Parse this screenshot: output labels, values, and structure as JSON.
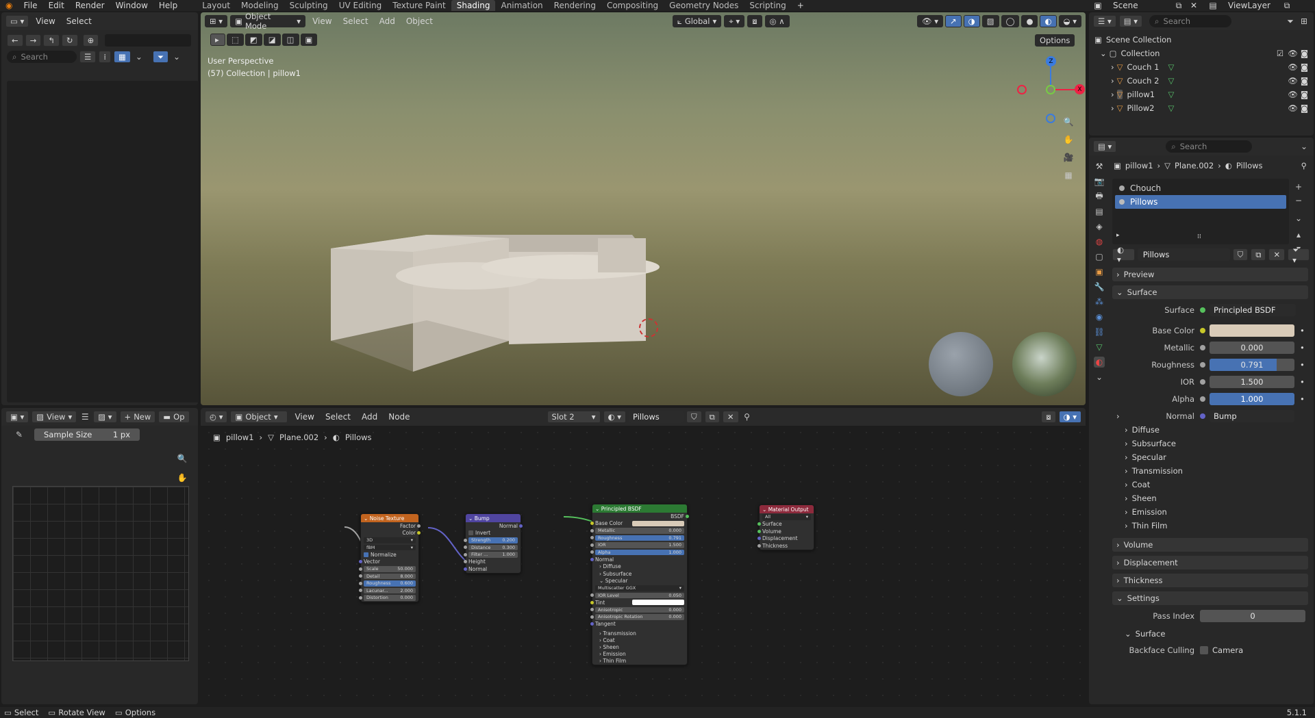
{
  "topbar": {
    "menus": [
      "File",
      "Edit",
      "Render",
      "Window",
      "Help"
    ],
    "workspaces": [
      "Layout",
      "Modeling",
      "Sculpting",
      "UV Editing",
      "Texture Paint",
      "Shading",
      "Animation",
      "Rendering",
      "Compositing",
      "Geometry Nodes",
      "Scripting"
    ],
    "active_workspace": "Shading",
    "scene": "Scene",
    "view_layer": "ViewLayer"
  },
  "filebrowser": {
    "menus": [
      "View",
      "Select"
    ],
    "search_placeholder": "Search"
  },
  "viewport": {
    "mode": "Object Mode",
    "menus": [
      "View",
      "Select",
      "Add",
      "Object"
    ],
    "orientation": "Global",
    "options": "Options",
    "overlay_line1": "User Perspective",
    "overlay_line2": "(57) Collection | pillow1",
    "gizmo": {
      "z": "Z",
      "x": "X"
    }
  },
  "image_editor": {
    "view": "View",
    "new": "New",
    "open": "Op",
    "sample_label": "Sample Size",
    "sample_value": "1 px"
  },
  "node_editor": {
    "type": "Object",
    "menus": [
      "View",
      "Select",
      "Add",
      "Node"
    ],
    "slot": "Slot 2",
    "material": "Pillows",
    "breadcrumb": [
      "pillow1",
      "Plane.002",
      "Pillows"
    ],
    "noise": {
      "title": "Noise Texture",
      "out1": "Factor",
      "out2": "Color",
      "dim": "3D",
      "type": "fBM",
      "normalize": "Normalize",
      "vector": "Vector",
      "fields": [
        [
          "Scale",
          "50.000"
        ],
        [
          "Detail",
          "8.000"
        ],
        [
          "Roughness",
          "0.600"
        ],
        [
          "Lacunar...",
          "2.000"
        ],
        [
          "Distortion",
          "0.000"
        ]
      ]
    },
    "bump": {
      "title": "Bump",
      "out": "Normal",
      "invert": "Invert",
      "fields": [
        [
          "Strength",
          "0.200"
        ],
        [
          "Distance",
          "0.300"
        ],
        [
          "Filter ...",
          "1.000"
        ]
      ],
      "in1": "Height",
      "in2": "Normal"
    },
    "bsdf": {
      "title": "Principled BSDF",
      "out": "BSDF",
      "base_color": "Base Color",
      "fields": [
        [
          "Metallic",
          "0.000"
        ],
        [
          "Roughness",
          "0.791"
        ],
        [
          "IOR",
          "1.500"
        ],
        [
          "Alpha",
          "1.000"
        ]
      ],
      "normal": "Normal",
      "subs": [
        "Diffuse",
        "Subsurface",
        "Specular"
      ],
      "dist": "Multiscatter GGX",
      "spec_fields": [
        [
          "IOR Level",
          "0.050"
        ]
      ],
      "tint": "Tint",
      "aniso": [
        [
          "Anisotropic",
          "0.000"
        ],
        [
          "Anisotropic Rotation",
          "0.000"
        ]
      ],
      "tangent": "Tangent",
      "subs2": [
        "Transmission",
        "Coat",
        "Sheen",
        "Emission",
        "Thin Film"
      ]
    },
    "output": {
      "title": "Material Output",
      "target": "All",
      "inputs": [
        "Surface",
        "Volume",
        "Displacement",
        "Thickness"
      ]
    }
  },
  "outliner": {
    "search_placeholder": "Search",
    "root": "Scene Collection",
    "collection": "Collection",
    "items": [
      "Couch 1",
      "Couch 2",
      "pillow1",
      "Pillow2"
    ]
  },
  "properties": {
    "search_placeholder": "Search",
    "breadcrumb": [
      "pillow1",
      "Plane.002",
      "Pillows"
    ],
    "slots": [
      "Chouch",
      "Pillows"
    ],
    "active_slot": "Pillows",
    "material": "Pillows",
    "sections": {
      "preview": "Preview",
      "surface": "Surface",
      "volume": "Volume",
      "displacement": "Displacement",
      "thickness": "Thickness",
      "settings": "Settings",
      "surface2": "Surface"
    },
    "surface_label": "Surface",
    "surface_value": "Principled BSDF",
    "base_color_label": "Base Color",
    "metallic_label": "Metallic",
    "metallic": "0.000",
    "roughness_label": "Roughness",
    "roughness": "0.791",
    "ior_label": "IOR",
    "ior": "1.500",
    "alpha_label": "Alpha",
    "alpha": "1.000",
    "normal_label": "Normal",
    "normal_value": "Bump",
    "subsections": [
      "Diffuse",
      "Subsurface",
      "Specular",
      "Transmission",
      "Coat",
      "Sheen",
      "Emission",
      "Thin Film"
    ],
    "pass_index_label": "Pass Index",
    "pass_index": "0",
    "backface_label": "Backface Culling",
    "backface_value": "Camera"
  },
  "statusbar": {
    "select": "Select",
    "rotate": "Rotate View",
    "options": "Options",
    "version": "5.1.1"
  },
  "colors": {
    "accent": "#4772b3",
    "base_color": "#d9cbb8"
  }
}
